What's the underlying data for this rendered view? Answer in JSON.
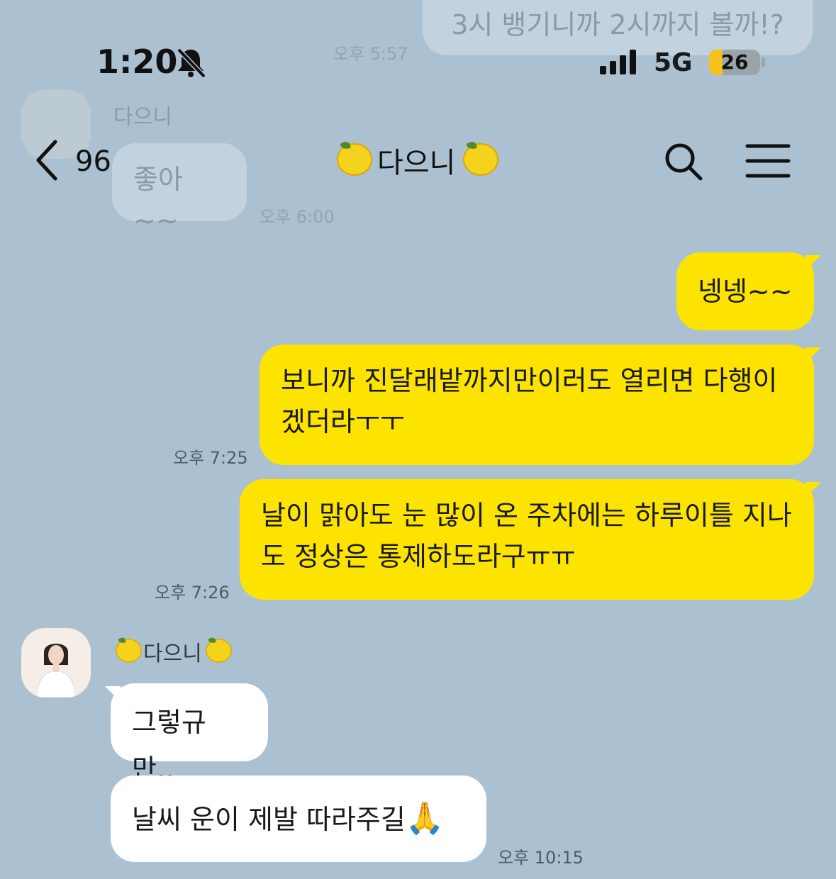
{
  "status_bar": {
    "time": "1:20",
    "network": "5G",
    "battery": "26"
  },
  "header": {
    "back_count": "96",
    "title": "다으니",
    "title_emoji": "lemon"
  },
  "faded": {
    "top_message": "3시 뱅기니까 2시까지 볼까!?",
    "top_time": "오후 5:57",
    "sender": "다으니",
    "message": "좋아~~",
    "time": "오후 6:00"
  },
  "messages": [
    {
      "from": "me",
      "text": "넹넹~~",
      "time": ""
    },
    {
      "from": "me",
      "text_line1": "보니까 진달래밭까지만이러도 열리면 다행이",
      "text_line2": "겠더라ㅜㅜ",
      "time": "오후 7:25"
    },
    {
      "from": "me",
      "text_line1": "날이 맑아도 눈 많이 온 주차에는 하루이틀 지나",
      "text_line2": "도 정상은 통제하도라구ㅠㅠ",
      "time": "오후 7:26"
    }
  ],
  "friend": {
    "sender": "다으니",
    "messages": [
      {
        "text": "그렇규만,,",
        "time": ""
      },
      {
        "text": "날씨 운이 제발 따라주길",
        "emoji": "🙏",
        "time": "오후 10:15"
      }
    ]
  },
  "colors": {
    "background": "#abc1d1",
    "my_bubble": "#fde400",
    "friend_bubble": "#ffffff"
  }
}
